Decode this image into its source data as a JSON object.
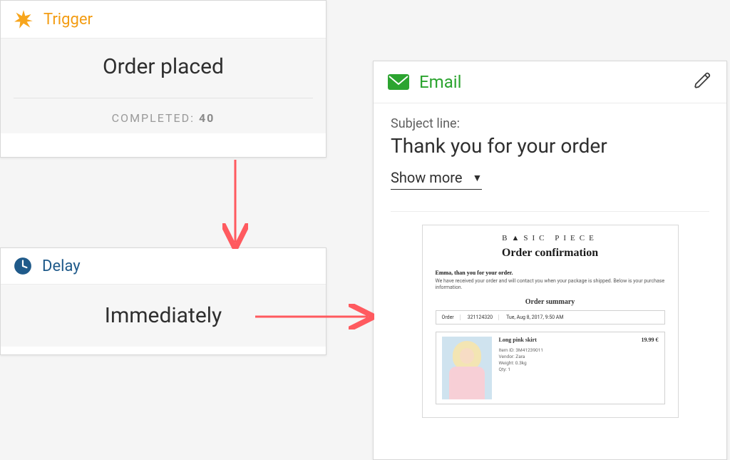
{
  "trigger": {
    "label": "Trigger",
    "main": "Order placed",
    "completed_label": "COMPLETED:",
    "completed_count": "40"
  },
  "delay": {
    "label": "Delay",
    "main": "Immediately"
  },
  "email": {
    "label": "Email",
    "subject_label": "Subject line:",
    "subject": "Thank you for your order",
    "show_more": "Show more",
    "preview": {
      "brand": "B▲SIC PIECE",
      "heading": "Order confirmation",
      "greeting": "Emma, than you for your order.",
      "body_text": "We have received your order and will contact you when your package is shipped. Below is your purchase information.",
      "summary_title": "Order summary",
      "order_label": "Order",
      "order_id": "321124320",
      "order_date": "Tue, Aug 8, 2017, 9:50 AM",
      "product_name": "Long pink skirt",
      "price": "19.99 €",
      "item_id": "Item ID: 3M41239011",
      "vendor": "Vendor: Zara",
      "weight": "Weight: 0.3kg",
      "qty": "Qty: 1"
    }
  }
}
